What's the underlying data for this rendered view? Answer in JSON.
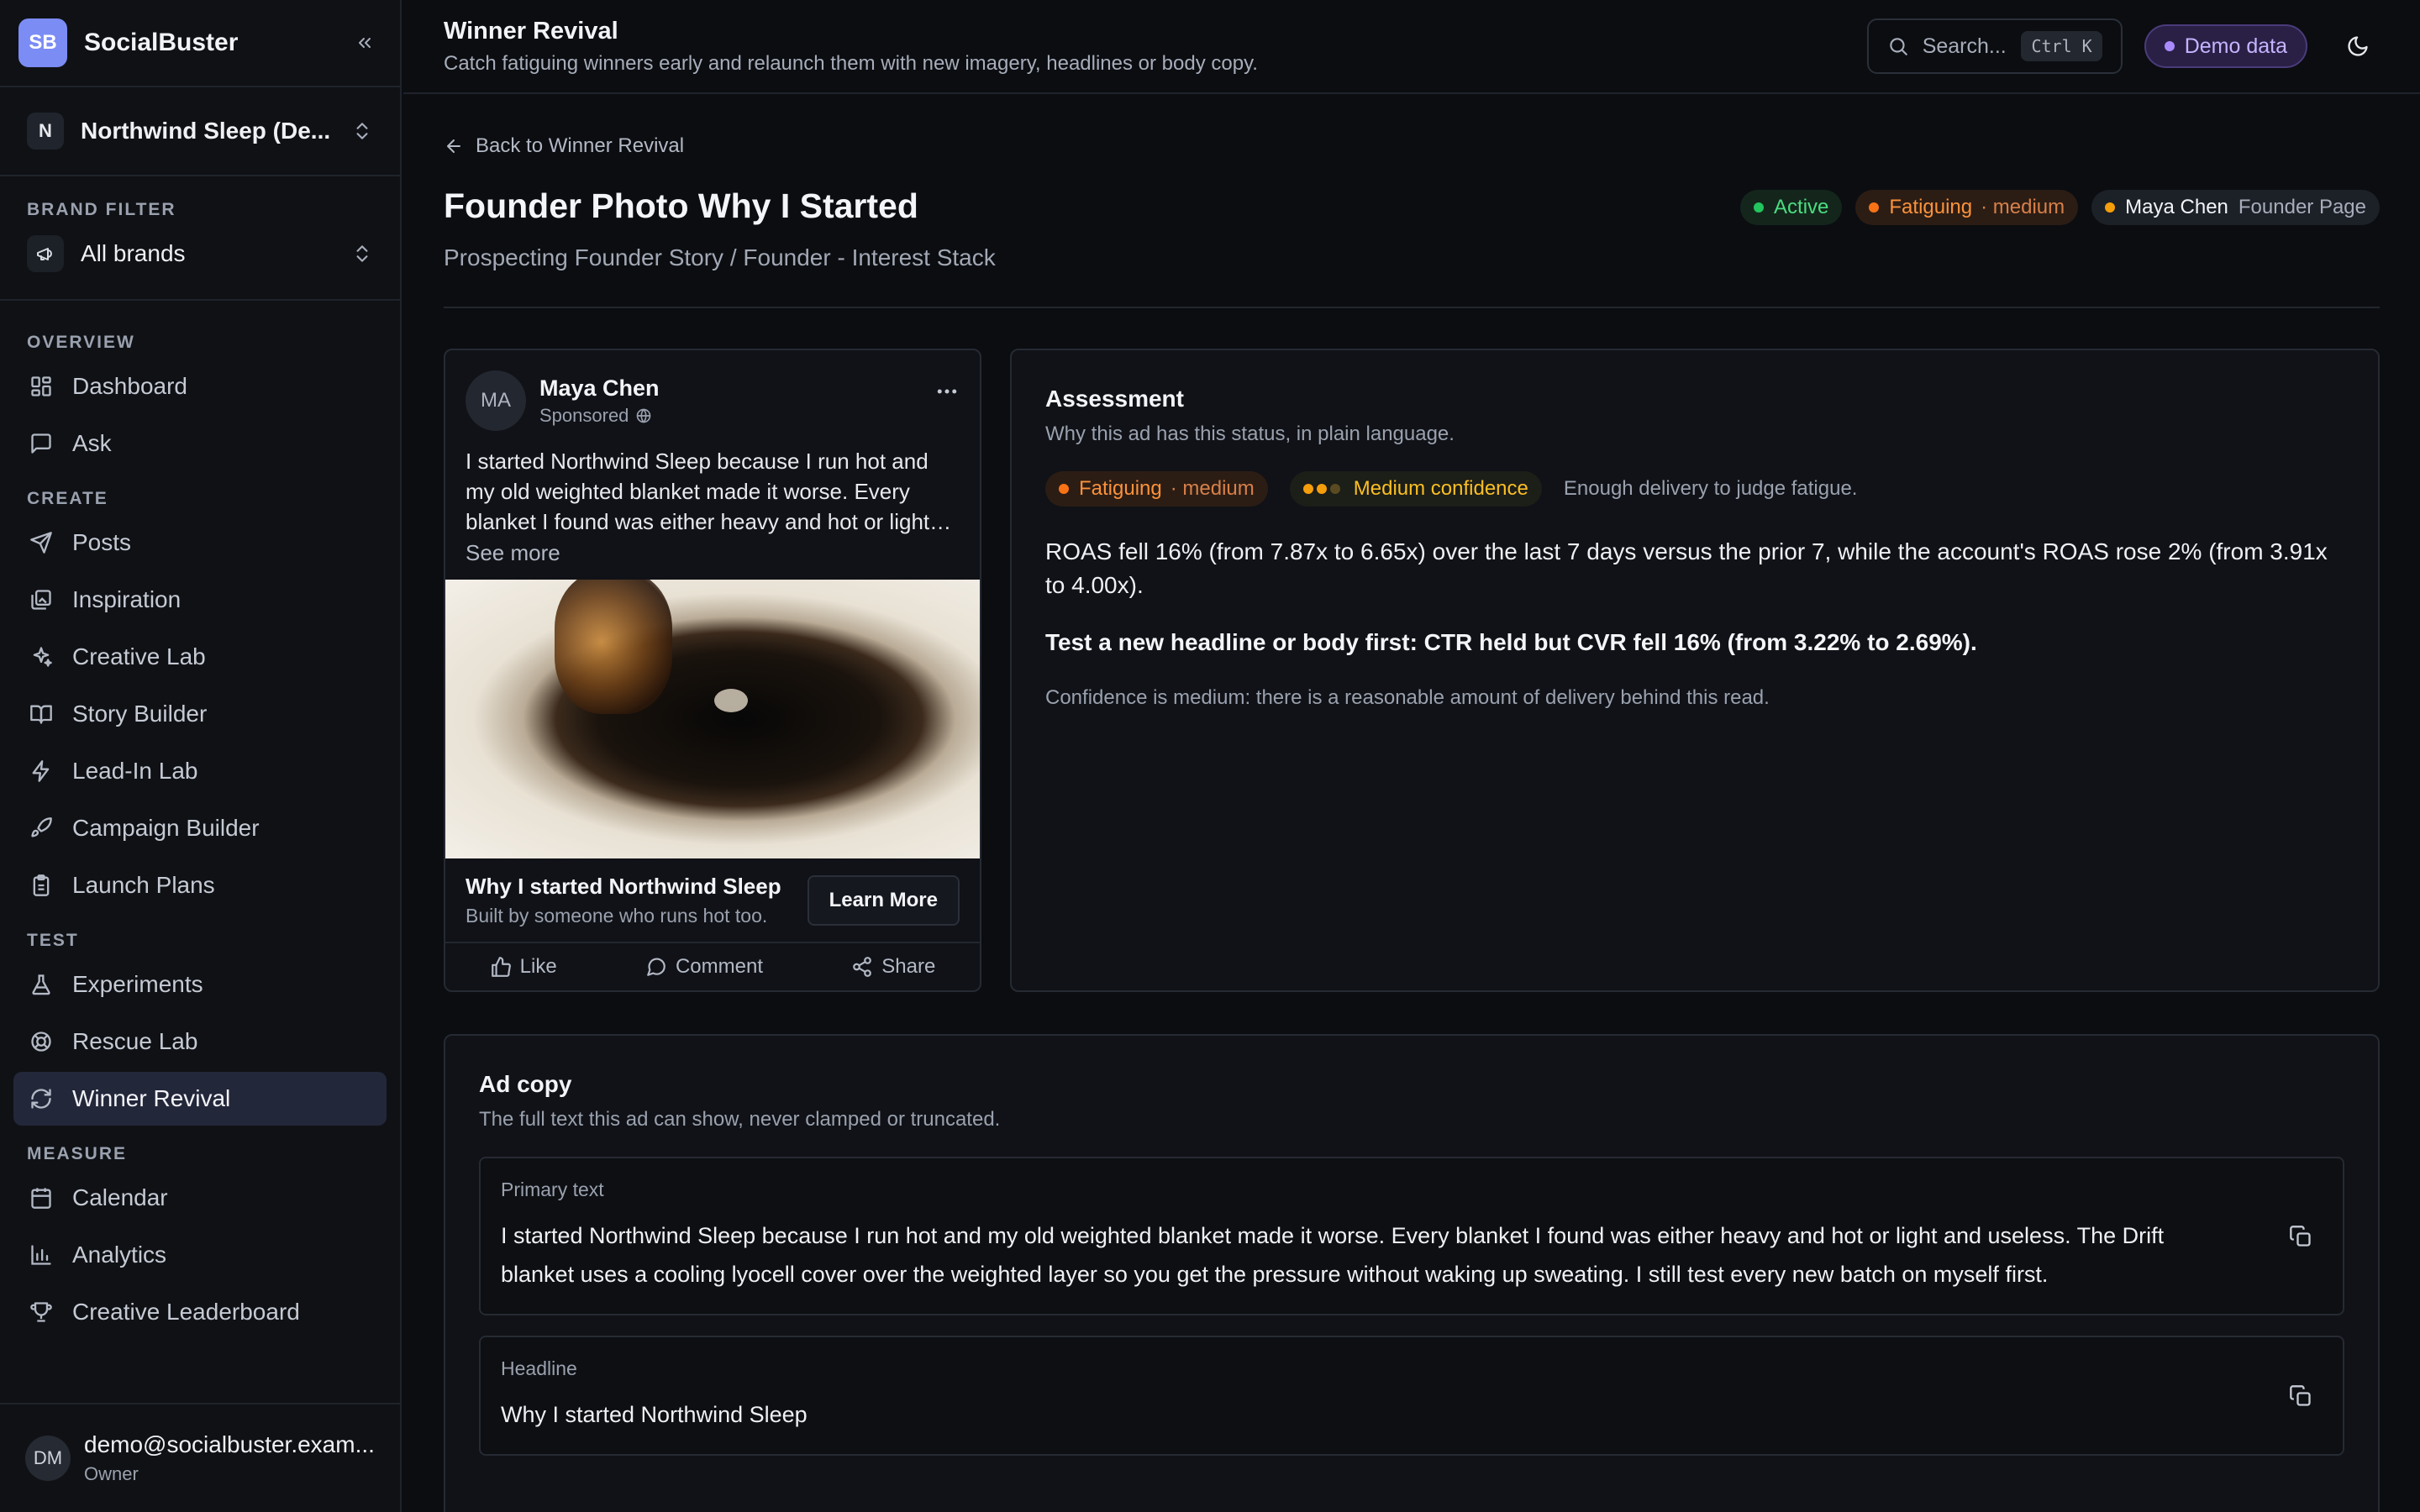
{
  "app": {
    "logo": "SB",
    "name": "SocialBuster"
  },
  "workspace": {
    "initial": "N",
    "name": "Northwind Sleep (De..."
  },
  "brand_filter": {
    "title": "BRAND FILTER",
    "value": "All brands"
  },
  "nav": {
    "overview": {
      "title": "OVERVIEW",
      "items": [
        "Dashboard",
        "Ask"
      ]
    },
    "create": {
      "title": "CREATE",
      "items": [
        "Posts",
        "Inspiration",
        "Creative Lab",
        "Story Builder",
        "Lead-In Lab",
        "Campaign Builder",
        "Launch Plans"
      ]
    },
    "test": {
      "title": "TEST",
      "items": [
        "Experiments",
        "Rescue Lab",
        "Winner Revival"
      ]
    },
    "measure": {
      "title": "MEASURE",
      "items": [
        "Calendar",
        "Analytics",
        "Creative Leaderboard"
      ]
    }
  },
  "user": {
    "initials": "DM",
    "email": "demo@socialbuster.exam...",
    "role": "Owner"
  },
  "topbar": {
    "title": "Winner Revival",
    "subtitle": "Catch fatiguing winners early and relaunch them with new imagery, headlines or body copy.",
    "search_placeholder": "Search...",
    "shortcut": "Ctrl K",
    "demo_label": "Demo data"
  },
  "page": {
    "back_label": "Back to Winner Revival",
    "title": "Founder Photo Why I Started",
    "subtitle": "Prospecting Founder Story / Founder - Interest Stack",
    "badges": {
      "status": "Active",
      "fatigue": "Fatiguing",
      "fatigue_level": "· medium",
      "owner": "Maya Chen",
      "owner_page": "Founder Page"
    }
  },
  "ad_preview": {
    "avatar": "MA",
    "name": "Maya Chen",
    "sponsored": "Sponsored",
    "text": "I started Northwind Sleep because I run hot and my old weighted blanket made it worse. Every blanket I found was either heavy and hot or light and useless. The Drift blanket uses a cooling lyocell cover over the weighted layer so you get the pressure without waking up sweating. I still test every new batch on myself first.",
    "see_more": "See more",
    "headline": "Why I started Northwind Sleep",
    "description": "Built by someone who runs hot too.",
    "cta": "Learn More",
    "actions": {
      "like": "Like",
      "comment": "Comment",
      "share": "Share"
    }
  },
  "assessment": {
    "title": "Assessment",
    "subtitle": "Why this ad has this status, in plain language.",
    "fatigue": "Fatiguing",
    "fatigue_level": "· medium",
    "confidence": "Medium confidence",
    "confidence_note": "Enough delivery to judge fatigue.",
    "paragraph1": "ROAS fell 16% (from 7.87x to 6.65x) over the last 7 days versus the prior 7, while the account's ROAS rose 2% (from 3.91x to 4.00x).",
    "paragraph2": "Test a new headline or body first: CTR held but CVR fell 16% (from 3.22% to 2.69%).",
    "note": "Confidence is medium: there is a reasonable amount of delivery behind this read."
  },
  "ad_copy": {
    "title": "Ad copy",
    "subtitle": "The full text this ad can show, never clamped or truncated.",
    "primary_label": "Primary text",
    "primary_text": "I started Northwind Sleep because I run hot and my old weighted blanket made it worse. Every blanket I found was either heavy and hot or light and useless. The Drift blanket uses a cooling lyocell cover over the weighted layer so you get the pressure without waking up sweating. I still test every new batch on myself first.",
    "headline_label": "Headline",
    "headline_text": "Why I started Northwind Sleep"
  },
  "colors": {
    "accent": "#7c8cf5",
    "active": "#22c55e",
    "fatigue": "#f97316",
    "confidence": "#f59e0b",
    "demo": "#a98bff"
  }
}
